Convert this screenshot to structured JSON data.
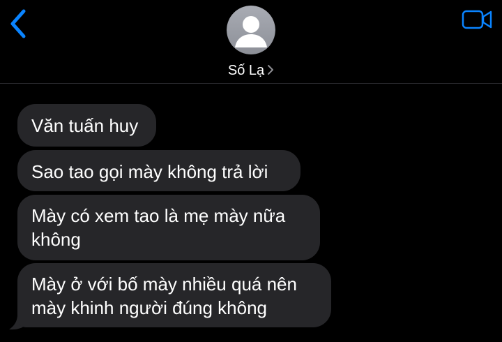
{
  "header": {
    "contact_name": "Số Lạ",
    "back_icon": "chevron-left-icon",
    "video_icon": "video-camera-icon",
    "avatar_icon": "person-silhouette-icon",
    "accent_color": "#0a84ff"
  },
  "messages": [
    {
      "direction": "incoming",
      "text": "Văn tuấn huy"
    },
    {
      "direction": "incoming",
      "text": "Sao tao gọi mày không trả lời"
    },
    {
      "direction": "incoming",
      "text": "Mày có xem tao là mẹ mày nữa không"
    },
    {
      "direction": "incoming",
      "text": "Mày ở với bố mày nhiều quá nên mày khinh người đúng không"
    }
  ],
  "colors": {
    "background": "#000000",
    "incoming_bubble": "#262629",
    "text": "#ffffff"
  }
}
